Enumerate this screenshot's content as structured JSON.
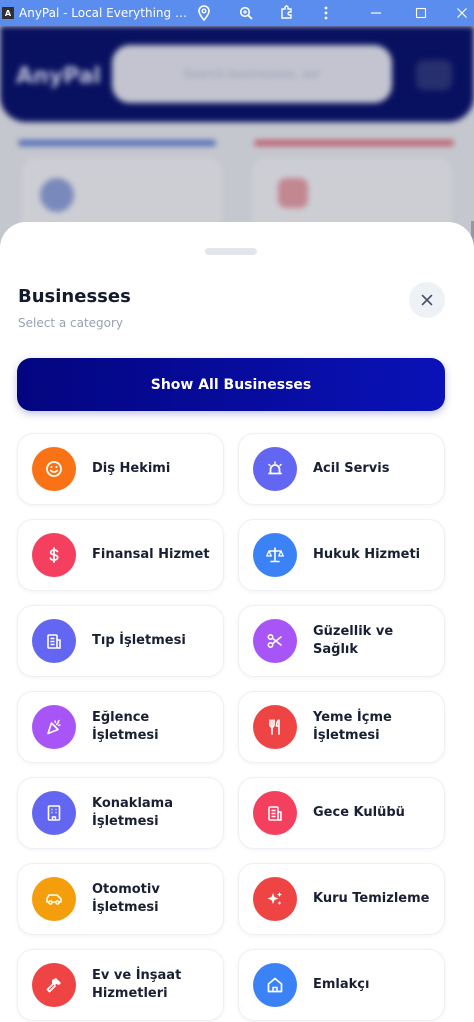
{
  "window": {
    "app_icon_letter": "A",
    "title": "AnyPal - Local Everything Pl...",
    "icons": [
      "location-icon",
      "zoom-icon",
      "extensions-icon",
      "more-icon",
      "minimize-icon",
      "maximize-icon",
      "close-window-icon"
    ]
  },
  "background": {
    "logo": "AnyPal",
    "search_placeholder": "Search businesses, ser"
  },
  "sheet": {
    "title": "Businesses",
    "subtitle": "Select a category",
    "close_icon": "close-icon",
    "show_all_label": "Show All Businesses",
    "categories": [
      {
        "label": "Diş Hekimi",
        "icon": "smile-icon",
        "color": "#f97316"
      },
      {
        "label": "Acil Servis",
        "icon": "siren-icon",
        "color": "#6366f1"
      },
      {
        "label": "Finansal Hizmet",
        "icon": "dollar-icon",
        "color": "#f43f5e"
      },
      {
        "label": "Hukuk Hizmeti",
        "icon": "scale-icon",
        "color": "#3b82f6"
      },
      {
        "label": "Tıp İşletmesi",
        "icon": "hospital-icon",
        "color": "#6366f1"
      },
      {
        "label": "Güzellik ve Sağlık",
        "icon": "scissors-icon",
        "color": "#a855f7"
      },
      {
        "label": "Eğlence İşletmesi",
        "icon": "party-icon",
        "color": "#a855f7"
      },
      {
        "label": "Yeme İçme İşletmesi",
        "icon": "utensils-icon",
        "color": "#ef4444"
      },
      {
        "label": "Konaklama İşletmesi",
        "icon": "hotel-icon",
        "color": "#6366f1"
      },
      {
        "label": "Gece Kulübü",
        "icon": "club-icon",
        "color": "#f43f5e"
      },
      {
        "label": "Otomotiv İşletmesi",
        "icon": "car-icon",
        "color": "#f59e0b"
      },
      {
        "label": "Kuru Temizleme",
        "icon": "sparkles-icon",
        "color": "#ef4444"
      },
      {
        "label": "Ev ve İnşaat Hizmetleri",
        "icon": "hammer-icon",
        "color": "#ef4444"
      },
      {
        "label": "Emlakçı",
        "icon": "home-icon",
        "color": "#3b82f6"
      }
    ]
  }
}
